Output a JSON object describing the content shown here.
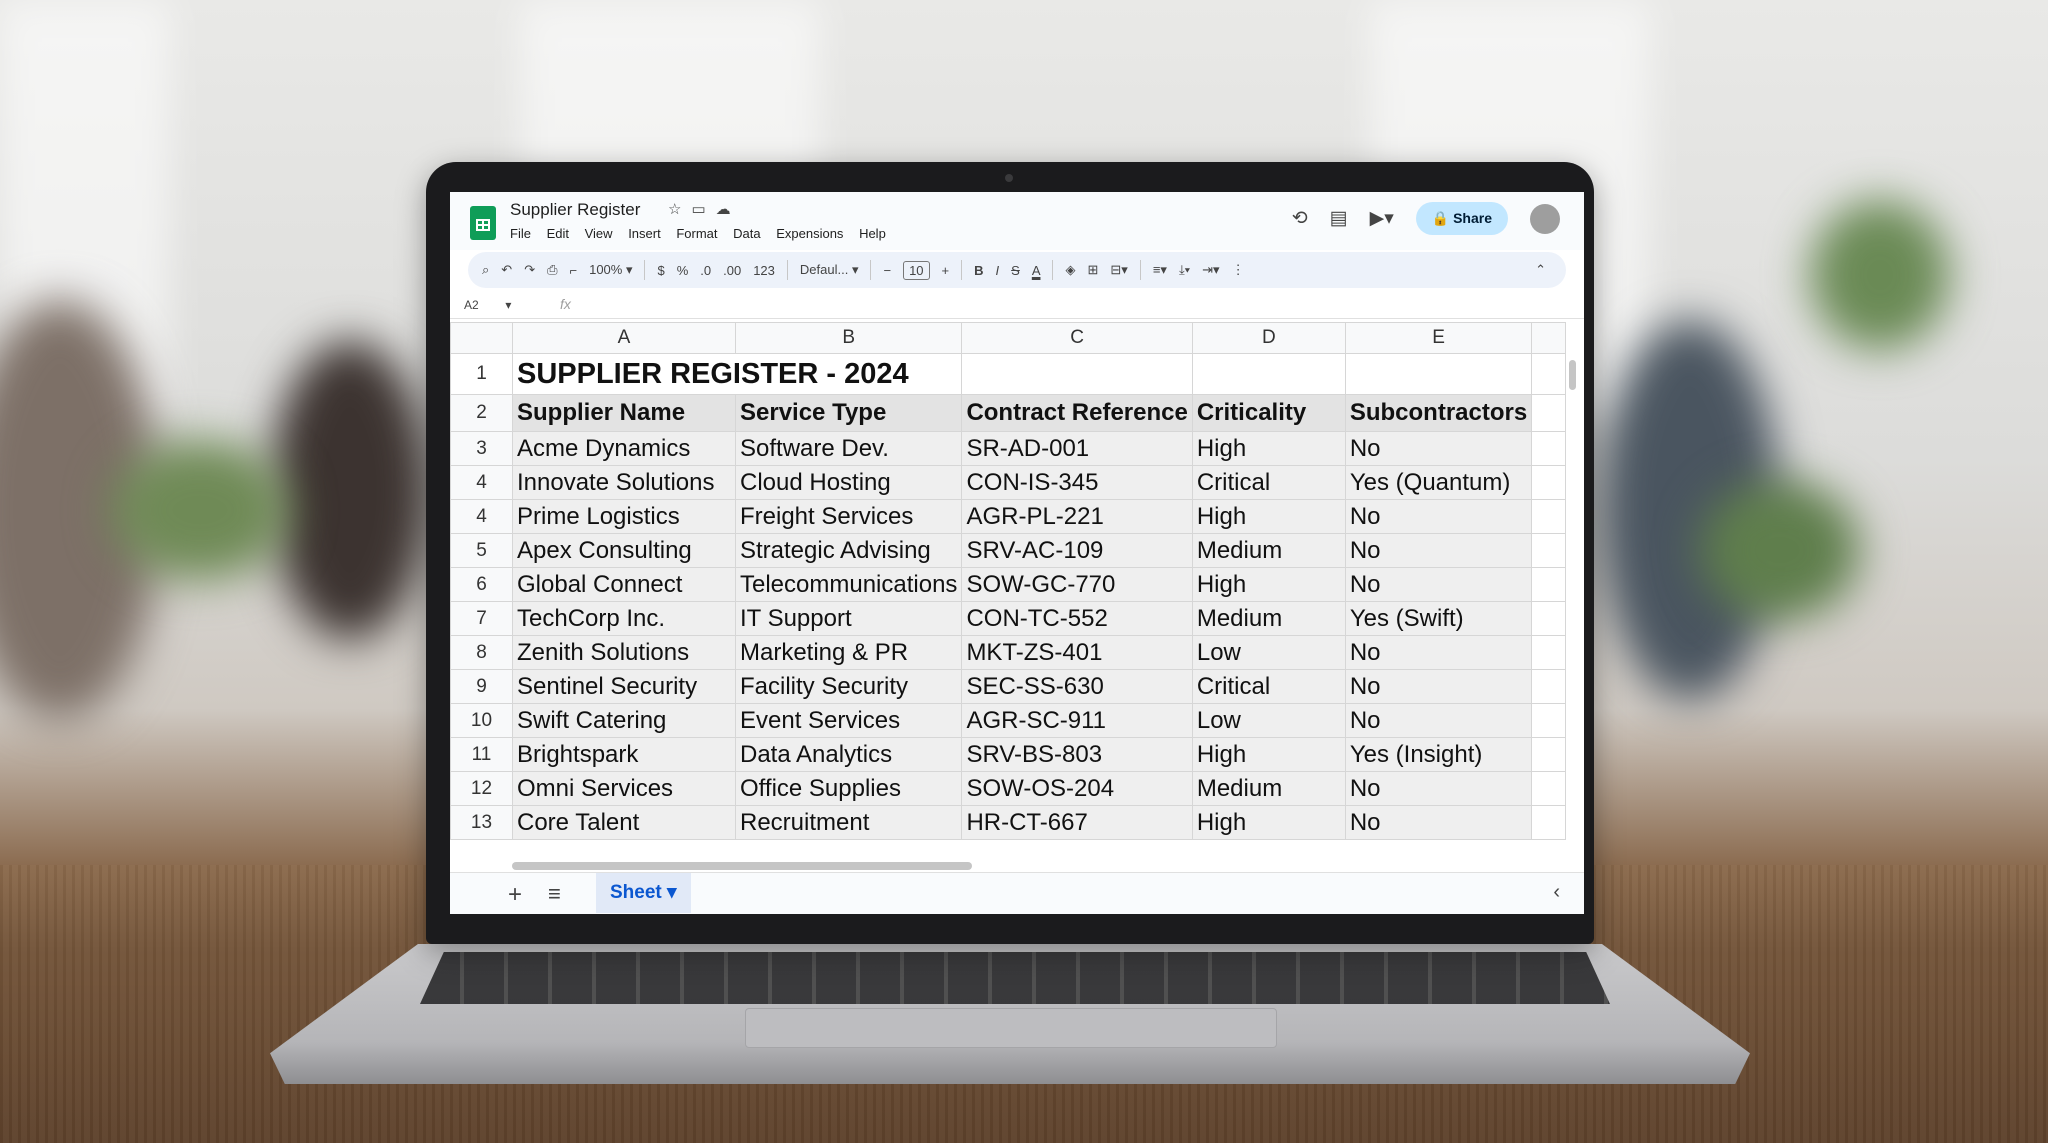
{
  "app": {
    "document_title": "Supplier Register",
    "title_icons": [
      "star-icon",
      "folder-icon",
      "cloud-icon"
    ],
    "menu": [
      "File",
      "Edit",
      "View",
      "Insert",
      "Format",
      "Data",
      "Expensions",
      "Help"
    ],
    "share_label": "Share"
  },
  "toolbar": {
    "zoom": "100%",
    "currency": "$",
    "percent": "%",
    "decrease_decimal": ".0",
    "increase_decimal": ".00",
    "number_format": "123",
    "font": "Defaul...",
    "font_size": "10",
    "bold": "B",
    "italic": "I",
    "strike": "S",
    "text_color": "A"
  },
  "formula_bar": {
    "cell_ref": "A2",
    "fx": "fx"
  },
  "grid": {
    "columns": [
      "A",
      "B",
      "C",
      "D",
      "E"
    ],
    "title_row": {
      "num": "1",
      "title": "SUPPLIER REGISTER - 2024"
    },
    "header_row": {
      "num": "2",
      "cells": [
        "Supplier Name",
        "Service Type",
        "Contract Reference",
        "Criticality",
        "Subcontractors"
      ]
    },
    "rows": [
      {
        "num": "3",
        "cells": [
          "Acme Dynamics",
          "Software Dev.",
          "SR-AD-001",
          "High",
          "No"
        ]
      },
      {
        "num": "4",
        "cells": [
          "Innovate Solutions",
          "Cloud Hosting",
          "CON-IS-345",
          "Critical",
          "Yes (Quantum)"
        ]
      },
      {
        "num": "4",
        "cells": [
          "Prime Logistics",
          "Freight Services",
          "AGR-PL-221",
          "High",
          "No"
        ]
      },
      {
        "num": "5",
        "cells": [
          "Apex Consulting",
          "Strategic Advising",
          "SRV-AC-109",
          "Medium",
          "No"
        ]
      },
      {
        "num": "6",
        "cells": [
          "Global Connect",
          "Telecommunications",
          "SOW-GC-770",
          "High",
          "No"
        ]
      },
      {
        "num": "7",
        "cells": [
          "TechCorp Inc.",
          "IT Support",
          "CON-TC-552",
          "Medium",
          "Yes (Swift)"
        ]
      },
      {
        "num": "8",
        "cells": [
          "Zenith Solutions",
          "Marketing & PR",
          "MKT-ZS-401",
          "Low",
          "No"
        ]
      },
      {
        "num": "9",
        "cells": [
          "Sentinel Security",
          "Facility Security",
          "SEC-SS-630",
          "Critical",
          "No"
        ]
      },
      {
        "num": "10",
        "cells": [
          "Swift Catering",
          "Event Services",
          "AGR-SC-911",
          "Low",
          "No"
        ]
      },
      {
        "num": "11",
        "cells": [
          "Brightspark",
          "Data Analytics",
          "SRV-BS-803",
          "High",
          "Yes (Insight)"
        ]
      },
      {
        "num": "12",
        "cells": [
          "Omni Services",
          "Office Supplies",
          "SOW-OS-204",
          "Medium",
          "No"
        ]
      },
      {
        "num": "13",
        "cells": [
          "Core Talent",
          "Recruitment",
          "HR-CT-667",
          "High",
          "No"
        ]
      }
    ]
  },
  "sheet_tabs": {
    "active": "Sheet"
  }
}
